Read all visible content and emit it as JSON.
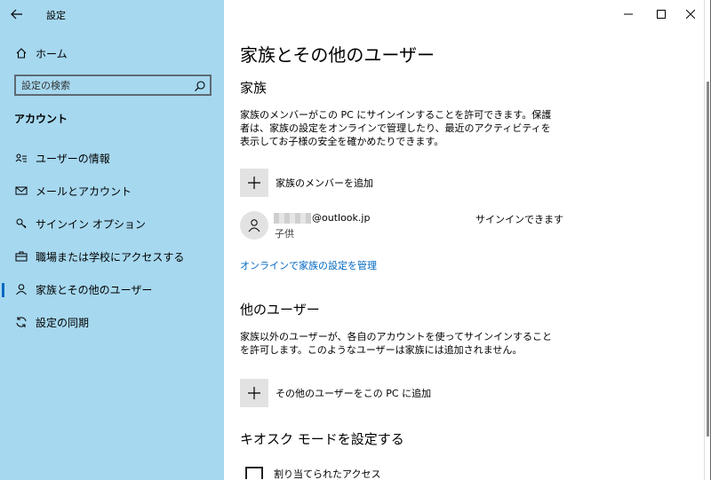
{
  "window": {
    "title": "設定",
    "controls": [
      "minimize-icon",
      "maximize-icon",
      "close-icon"
    ]
  },
  "sidebar": {
    "home_label": "ホーム",
    "search_placeholder": "設定の検索",
    "section_label": "アカウント",
    "items": [
      {
        "label": "ユーザーの情報",
        "icon": "user-info-icon"
      },
      {
        "label": "メールとアカウント",
        "icon": "mail-icon"
      },
      {
        "label": "サインイン オプション",
        "icon": "key-icon"
      },
      {
        "label": "職場または学校にアクセスする",
        "icon": "briefcase-icon"
      },
      {
        "label": "家族とその他のユーザー",
        "icon": "person-icon",
        "selected": true
      },
      {
        "label": "設定の同期",
        "icon": "sync-icon"
      }
    ]
  },
  "main": {
    "page_title": "家族とその他のユーザー",
    "family": {
      "heading": "家族",
      "description": "家族のメンバーがこの PC にサインインすることを許可できます。保護者は、家族の設定をオンラインで管理したり、最近のアクティビティを表示してお子様の安全を確かめたりできます。",
      "add_label": "家族のメンバーを追加",
      "member": {
        "email": "@outlook.jp",
        "role": "子供",
        "status": "サインインできます"
      },
      "manage_link": "オンラインで家族の設定を管理"
    },
    "other_users": {
      "heading": "他のユーザー",
      "description": "家族以外のユーザーが、各自のアカウントを使ってサインインすることを許可します。このようなユーザーは家族には追加されません。",
      "add_label": "その他のユーザーをこの PC に追加"
    },
    "kiosk": {
      "heading": "キオスク モードを設定する",
      "item_label": "割り当てられたアクセス"
    }
  },
  "colors": {
    "sidebar_bg": "#a6d8ef",
    "accent": "#0067c0",
    "tile_bg": "#e2e2e2"
  }
}
